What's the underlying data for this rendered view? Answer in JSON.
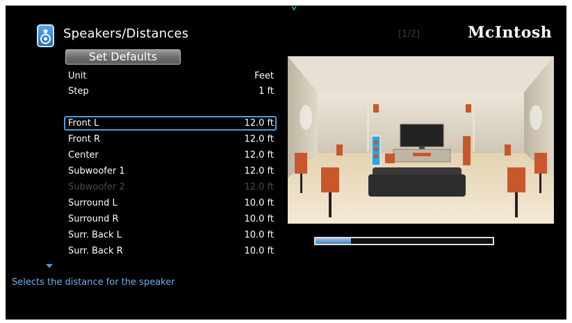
{
  "header": {
    "title": "Speakers/Distances",
    "page_indicator": "[1/2]",
    "brand": "McIntosh",
    "icon": "speaker-icon"
  },
  "set_defaults_label": "Set Defaults",
  "settings": [
    {
      "label": "Unit",
      "value": "Feet"
    },
    {
      "label": "Step",
      "value": "1 ft"
    }
  ],
  "speakers": [
    {
      "label": "Front L",
      "value": "12.0 ft",
      "state": "selected"
    },
    {
      "label": "Front R",
      "value": "12.0 ft",
      "state": "normal"
    },
    {
      "label": "Center",
      "value": "12.0 ft",
      "state": "normal"
    },
    {
      "label": "Subwoofer 1",
      "value": "12.0 ft",
      "state": "normal"
    },
    {
      "label": "Subwoofer 2",
      "value": "12.0 ft",
      "state": "disabled"
    },
    {
      "label": "Surround L",
      "value": "10.0 ft",
      "state": "normal"
    },
    {
      "label": "Surround R",
      "value": "10.0 ft",
      "state": "normal"
    },
    {
      "label": "Surr. Back L",
      "value": "10.0 ft",
      "state": "normal"
    },
    {
      "label": "Surr. Back R",
      "value": "10.0 ft",
      "state": "normal"
    }
  ],
  "help_text": "Selects the distance for the speaker",
  "progress": 0.2,
  "colors": {
    "background": "#000000",
    "highlight": "#4a9ee0",
    "help_text": "#6fb2f0",
    "disabled_text": "#4a4a4a",
    "room_wall": "#d9d2c3",
    "speaker_wood": "#c8582c",
    "speaker_selected": "#2fa4e0"
  }
}
